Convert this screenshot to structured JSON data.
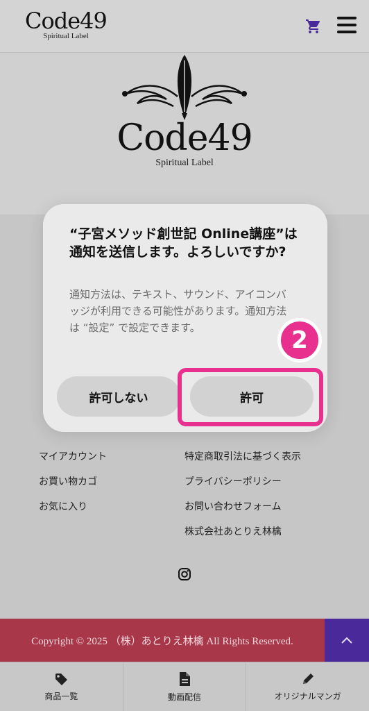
{
  "header": {
    "logo_name": "Code49",
    "logo_sub": "Spiritual Label",
    "cart_icon": "cart-icon",
    "menu_icon": "hamburger-menu-icon"
  },
  "hero": {
    "logo_name": "Code49",
    "logo_sub": "Spiritual Label"
  },
  "footer_links": {
    "account": [
      "マイアカウント",
      "お買い物カゴ",
      "お気に入り"
    ],
    "info": [
      "特定商取引法に基づく表示",
      "プライバシーポリシー",
      "お問い合わせフォーム",
      "株式会社あとりえ林檎"
    ]
  },
  "copyright": "Copyright © 2025 （株）あとりえ林檎 All Rights Reserved.",
  "tabs": [
    {
      "label": "商品一覧",
      "icon": "tag-icon"
    },
    {
      "label": "動画配信",
      "icon": "document-icon"
    },
    {
      "label": "オリジナルマンガ",
      "icon": "pencil-icon"
    }
  ],
  "dialog": {
    "title": "“子宮メソッド創世記 Online講座”は通知を送信します。よろしいですか?",
    "message": "通知方法は、テキスト、サウンド、アイコンバッジが利用できる可能性があります。通知方法は “設定” で設定できます。",
    "deny_label": "許可しない",
    "allow_label": "許可"
  },
  "annotation": {
    "step": "2",
    "color": "#e8318f"
  }
}
